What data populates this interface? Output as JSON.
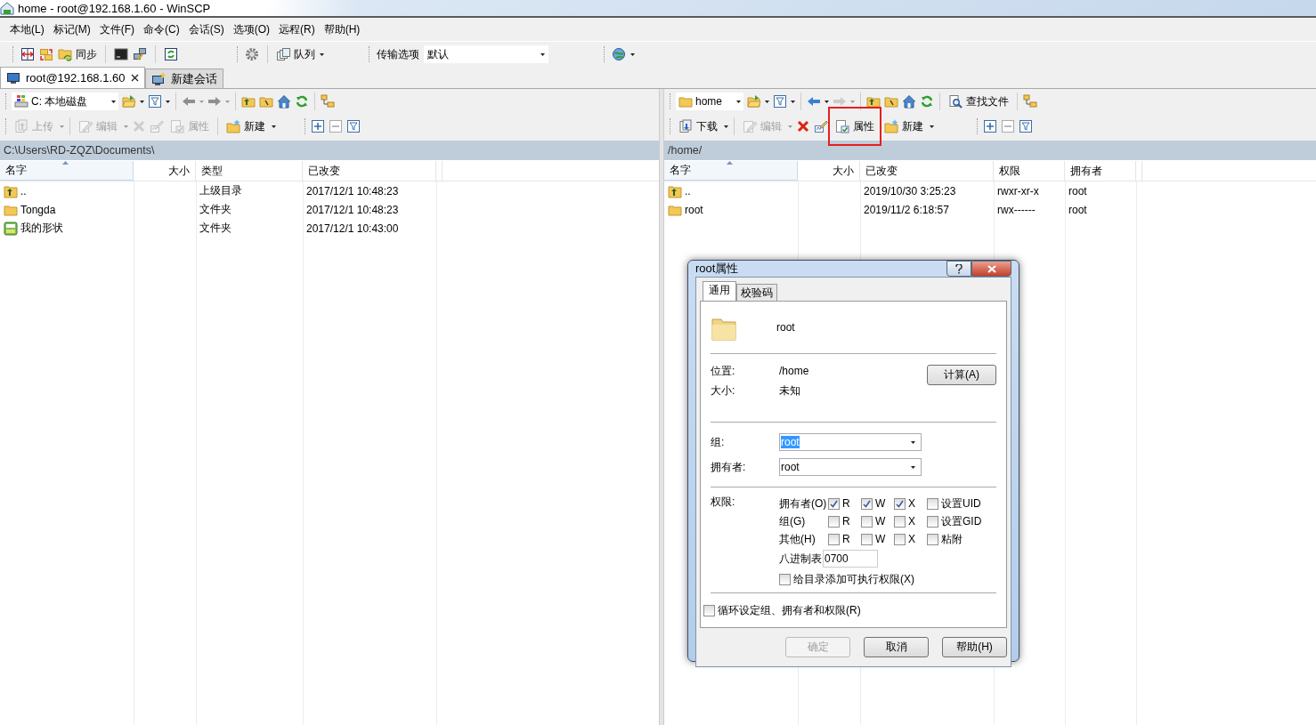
{
  "window": {
    "title": "home - root@192.168.1.60 - WinSCP"
  },
  "menu": [
    "本地(L)",
    "标记(M)",
    "文件(F)",
    "命令(C)",
    "会话(S)",
    "选项(O)",
    "远程(R)",
    "帮助(H)"
  ],
  "toolbar": {
    "sync_label": "同步",
    "queue_label": "队列",
    "transfer_label": "传输选项",
    "transfer_value": "默认"
  },
  "session_tabs": [
    {
      "label": "root@192.168.1.60",
      "selected": true,
      "kind": "session"
    },
    {
      "label": "新建会话",
      "selected": false,
      "kind": "new"
    }
  ],
  "panels": [
    {
      "kind": "local",
      "location": "C: 本地磁盘",
      "actions": [
        {
          "label": "上传",
          "disabled": true,
          "highlighted": false
        },
        {
          "label": "编辑",
          "disabled": true,
          "highlighted": false
        },
        {
          "label": "属性",
          "disabled": true,
          "highlighted": false
        },
        {
          "label": "新建",
          "disabled": false,
          "highlighted": false
        }
      ],
      "path": "C:\\Users\\RD-ZQZ\\Documents\\",
      "columns": [
        {
          "label": "名字",
          "sorted": true,
          "kind": "name"
        },
        {
          "label": "大小",
          "sorted": false,
          "kind": "size"
        },
        {
          "label": "类型",
          "sorted": false,
          "kind": "text"
        },
        {
          "label": "已改变",
          "sorted": false,
          "kind": "text"
        }
      ],
      "rows": [
        {
          "kind": "parent",
          "cells": [
            "..",
            "",
            "上级目录",
            "2017/12/1   10:48:23"
          ]
        },
        {
          "kind": "folder",
          "cells": [
            "Tongda",
            "",
            "文件夹",
            "2017/12/1   10:48:23"
          ]
        },
        {
          "kind": "special",
          "cells": [
            "我的形状",
            "",
            "文件夹",
            "2017/12/1   10:43:00"
          ]
        }
      ]
    },
    {
      "kind": "remote",
      "location": "home",
      "find_label": "查找文件",
      "actions": [
        {
          "label": "下载",
          "disabled": false,
          "highlighted": false
        },
        {
          "label": "编辑",
          "disabled": true,
          "highlighted": false
        },
        {
          "label": "属性",
          "disabled": false,
          "highlighted": true
        },
        {
          "label": "新建",
          "disabled": false,
          "highlighted": false
        }
      ],
      "path": "/home/",
      "columns": [
        {
          "label": "名字",
          "sorted": true,
          "kind": "name"
        },
        {
          "label": "大小",
          "sorted": false,
          "kind": "size"
        },
        {
          "label": "已改变",
          "sorted": false,
          "kind": "text"
        },
        {
          "label": "权限",
          "sorted": false,
          "kind": "text"
        },
        {
          "label": "拥有者",
          "sorted": false,
          "kind": "text"
        }
      ],
      "rows": [
        {
          "kind": "parent",
          "cells": [
            "..",
            "",
            "2019/10/30 3:25:23",
            "rwxr-xr-x",
            "root"
          ]
        },
        {
          "kind": "folder",
          "cells": [
            "root",
            "",
            "2019/11/2 6:18:57",
            "rwx------",
            "root"
          ]
        }
      ]
    }
  ],
  "dialog": {
    "title": "root属性",
    "tabs": [
      {
        "label": "通用",
        "selected": true
      },
      {
        "label": "校验码",
        "selected": false
      }
    ],
    "name": "root",
    "info": [
      {
        "label": "位置:",
        "value": "/home"
      },
      {
        "label": "大小:",
        "value": "未知"
      }
    ],
    "calc_button": "计算(A)",
    "combos": [
      {
        "label": "组:",
        "value": "root",
        "highlighted": true
      },
      {
        "label": "拥有者:",
        "value": "root",
        "highlighted": false
      }
    ],
    "permissions_label": "权限:",
    "permissions": [
      {
        "label": "拥有者(O)",
        "flags": [
          {
            "label": "R",
            "checked": true
          },
          {
            "label": "W",
            "checked": true
          },
          {
            "label": "X",
            "checked": true
          },
          {
            "label": "设置UID",
            "checked": false
          }
        ]
      },
      {
        "label": "组(G)",
        "flags": [
          {
            "label": "R",
            "checked": false
          },
          {
            "label": "W",
            "checked": false
          },
          {
            "label": "X",
            "checked": false
          },
          {
            "label": "设置GID",
            "checked": false
          }
        ]
      },
      {
        "label": "其他(H)",
        "flags": [
          {
            "label": "R",
            "checked": false
          },
          {
            "label": "W",
            "checked": false
          },
          {
            "label": "X",
            "checked": false
          },
          {
            "label": "粘附",
            "checked": false
          }
        ]
      }
    ],
    "octal_label": "八进制表",
    "octal_value": "0700",
    "dir_exec": {
      "label": "给目录添加可执行权限(X)",
      "checked": false
    },
    "recursive": {
      "label": "循环设定组、拥有者和权限(R)",
      "checked": false
    },
    "buttons": [
      {
        "label": "确定",
        "disabled": true
      },
      {
        "label": "取消",
        "disabled": false
      },
      {
        "label": "帮助(H)",
        "disabled": false
      }
    ]
  }
}
